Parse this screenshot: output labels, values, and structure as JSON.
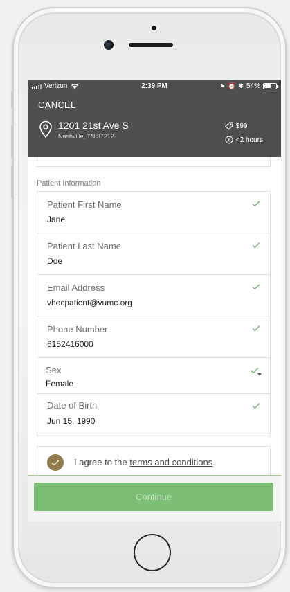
{
  "status_bar": {
    "carrier": "Verizon",
    "time": "2:39 PM",
    "battery": "54%",
    "battery_level": 0.54
  },
  "header": {
    "cancel_label": "CANCEL",
    "address_line1": "1201 21st Ave S",
    "address_line2": "Nashville, TN 37212",
    "price": "$99",
    "wait_time": "<2 hours"
  },
  "form": {
    "section_title": "Patient Information",
    "fields": [
      {
        "label": "Patient First Name",
        "value": "Jane"
      },
      {
        "label": "Patient Last Name",
        "value": "Doe"
      },
      {
        "label": "Email Address",
        "value": "vhocpatient@vumc.org"
      },
      {
        "label": "Phone Number",
        "value": "6152416000"
      },
      {
        "label": "Sex",
        "value": "Female"
      },
      {
        "label": "Date of Birth",
        "value": "Jun 15, 1990"
      }
    ]
  },
  "agreement": {
    "prefix": "I agree to the ",
    "link_text": "terms and conditions",
    "suffix": ".",
    "checked": true
  },
  "footer": {
    "continue_label": "Continue"
  },
  "colors": {
    "header_bg": "#4f4f4d",
    "check_green": "#6cb26c",
    "agree_gold": "#8f7c4d",
    "continue_bg": "#7bbd74"
  },
  "icons": {
    "location": "map-pin-icon",
    "price": "price-tag-icon",
    "time": "clock-icon",
    "valid": "checkmark-icon"
  }
}
